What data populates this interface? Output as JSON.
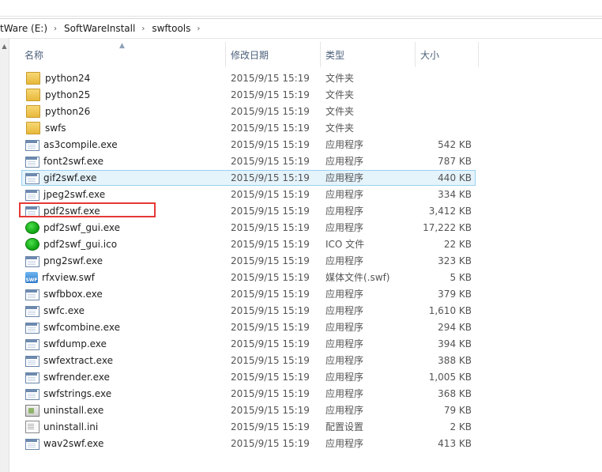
{
  "address": {
    "crumbs": [
      "tWare (E:)",
      "SoftWareInstall",
      "swftools"
    ],
    "separator": "›"
  },
  "columns": {
    "name": "名称",
    "date": "修改日期",
    "type": "类型",
    "size": "大小"
  },
  "files": [
    {
      "name": "python24",
      "date": "2015/9/15 15:19",
      "type": "文件夹",
      "size": "",
      "icon": "folder-icon"
    },
    {
      "name": "python25",
      "date": "2015/9/15 15:19",
      "type": "文件夹",
      "size": "",
      "icon": "folder-icon"
    },
    {
      "name": "python26",
      "date": "2015/9/15 15:19",
      "type": "文件夹",
      "size": "",
      "icon": "folder-icon"
    },
    {
      "name": "swfs",
      "date": "2015/9/15 15:19",
      "type": "文件夹",
      "size": "",
      "icon": "folder-icon"
    },
    {
      "name": "as3compile.exe",
      "date": "2015/9/15 15:19",
      "type": "应用程序",
      "size": "542 KB",
      "icon": "exe-icon"
    },
    {
      "name": "font2swf.exe",
      "date": "2015/9/15 15:19",
      "type": "应用程序",
      "size": "787 KB",
      "icon": "exe-icon"
    },
    {
      "name": "gif2swf.exe",
      "date": "2015/9/15 15:19",
      "type": "应用程序",
      "size": "440 KB",
      "icon": "exe-icon",
      "selected": true
    },
    {
      "name": "jpeg2swf.exe",
      "date": "2015/9/15 15:19",
      "type": "应用程序",
      "size": "334 KB",
      "icon": "exe-icon"
    },
    {
      "name": "pdf2swf.exe",
      "date": "2015/9/15 15:19",
      "type": "应用程序",
      "size": "3,412 KB",
      "icon": "exe-icon"
    },
    {
      "name": "pdf2swf_gui.exe",
      "date": "2015/9/15 15:19",
      "type": "应用程序",
      "size": "17,222 KB",
      "icon": "gui-icon"
    },
    {
      "name": "pdf2swf_gui.ico",
      "date": "2015/9/15 15:19",
      "type": "ICO 文件",
      "size": "22 KB",
      "icon": "gui-icon"
    },
    {
      "name": "png2swf.exe",
      "date": "2015/9/15 15:19",
      "type": "应用程序",
      "size": "323 KB",
      "icon": "exe-icon"
    },
    {
      "name": "rfxview.swf",
      "date": "2015/9/15 15:19",
      "type": "媒体文件(.swf)",
      "size": "5 KB",
      "icon": "swf-icon"
    },
    {
      "name": "swfbbox.exe",
      "date": "2015/9/15 15:19",
      "type": "应用程序",
      "size": "379 KB",
      "icon": "exe-icon"
    },
    {
      "name": "swfc.exe",
      "date": "2015/9/15 15:19",
      "type": "应用程序",
      "size": "1,610 KB",
      "icon": "exe-icon"
    },
    {
      "name": "swfcombine.exe",
      "date": "2015/9/15 15:19",
      "type": "应用程序",
      "size": "294 KB",
      "icon": "exe-icon"
    },
    {
      "name": "swfdump.exe",
      "date": "2015/9/15 15:19",
      "type": "应用程序",
      "size": "394 KB",
      "icon": "exe-icon"
    },
    {
      "name": "swfextract.exe",
      "date": "2015/9/15 15:19",
      "type": "应用程序",
      "size": "388 KB",
      "icon": "exe-icon"
    },
    {
      "name": "swfrender.exe",
      "date": "2015/9/15 15:19",
      "type": "应用程序",
      "size": "1,005 KB",
      "icon": "exe-icon"
    },
    {
      "name": "swfstrings.exe",
      "date": "2015/9/15 15:19",
      "type": "应用程序",
      "size": "368 KB",
      "icon": "exe-icon"
    },
    {
      "name": "uninstall.exe",
      "date": "2015/9/15 15:19",
      "type": "应用程序",
      "size": "79 KB",
      "icon": "uninstall-icon"
    },
    {
      "name": "uninstall.ini",
      "date": "2015/9/15 15:19",
      "type": "配置设置",
      "size": "2 KB",
      "icon": "ini-icon"
    },
    {
      "name": "wav2swf.exe",
      "date": "2015/9/15 15:19",
      "type": "应用程序",
      "size": "413 KB",
      "icon": "exe-icon"
    }
  ],
  "colors": {
    "selection_bg": "#e5f3fb",
    "selection_border": "#99d1f0",
    "highlight_box": "#e53935",
    "header_text": "#4c607a"
  }
}
